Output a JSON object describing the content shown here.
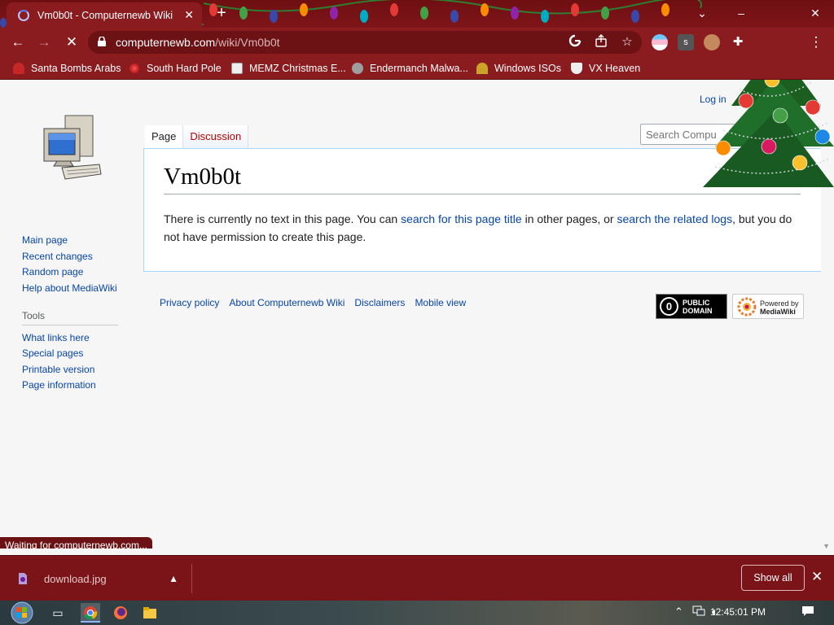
{
  "browser": {
    "tab": {
      "title": "Vm0b0t - Computernewb Wiki",
      "close": "✕"
    },
    "new_tab": "+",
    "window_controls": {
      "list": "⌄",
      "minimize": "–",
      "close": "✕"
    },
    "nav": {
      "back": "←",
      "forward": "→",
      "stop": "✕"
    },
    "url": {
      "host": "computernewb.com",
      "path": "/wiki/Vm0b0t"
    },
    "omnibox_icons": [
      "google-icon",
      "share-icon",
      "bookmark-star-icon"
    ],
    "extensions": [
      "flag-extension-icon",
      "s-extension-icon",
      "avatar-extension-icon",
      "puzzle-extensions-icon"
    ],
    "menu": "⋮",
    "ext_s_letter": "s",
    "bookmarks": [
      {
        "label": "Santa Bombs Arabs",
        "icon": "santa-icon",
        "color": "#c62828"
      },
      {
        "label": "South Hard Pole",
        "icon": "spark-icon",
        "color": "#b71c1c"
      },
      {
        "label": "MEMZ Christmas E...",
        "icon": "page-icon",
        "color": "#eeeeee"
      },
      {
        "label": "Endermanch Malwa...",
        "icon": "raccoon-icon",
        "color": "#9e9e9e"
      },
      {
        "label": "Windows ISOs",
        "icon": "figure-icon",
        "color": "#c9a227"
      },
      {
        "label": "VX Heaven",
        "icon": "shield-icon",
        "color": "#eeeeee"
      }
    ]
  },
  "wiki": {
    "login": "Log in",
    "search_placeholder": "Search Compu",
    "tabs": {
      "page": "Page",
      "discussion": "Discussion"
    },
    "title": "Vm0b0t",
    "notice": {
      "part1": "There is currently no text in this page. You can ",
      "link1": "search for this page title",
      "part2": " in other pages, or ",
      "link2": "search the related logs",
      "part3": ", but you do not have permission to create this page."
    },
    "nav_links": [
      "Main page",
      "Recent changes",
      "Random page",
      "Help about MediaWiki"
    ],
    "tools_heading": "Tools",
    "tools_links": [
      "What links here",
      "Special pages",
      "Printable version",
      "Page information"
    ],
    "footer_links": [
      "Privacy policy",
      "About Computernewb Wiki",
      "Disclaimers",
      "Mobile view"
    ],
    "badge_pd": {
      "line1": "PUBLIC",
      "line2": "DOMAIN"
    },
    "badge_mw": {
      "line1": "Powered by",
      "line2": "MediaWiki"
    }
  },
  "status": "Waiting for computernewb.com...",
  "downloads": {
    "file": "download.jpg",
    "show_all": "Show all",
    "close": "✕"
  },
  "taskbar": {
    "clock": "12:45:01 PM",
    "tray_icons": [
      "chevron-up-icon",
      "network-icon",
      "volume-icon",
      "notification-icon"
    ]
  },
  "colors": {
    "chrome": "#8a1b1f",
    "tabstrip": "#6e0f12",
    "link": "#0645ad",
    "redlink": "#ba0000"
  }
}
